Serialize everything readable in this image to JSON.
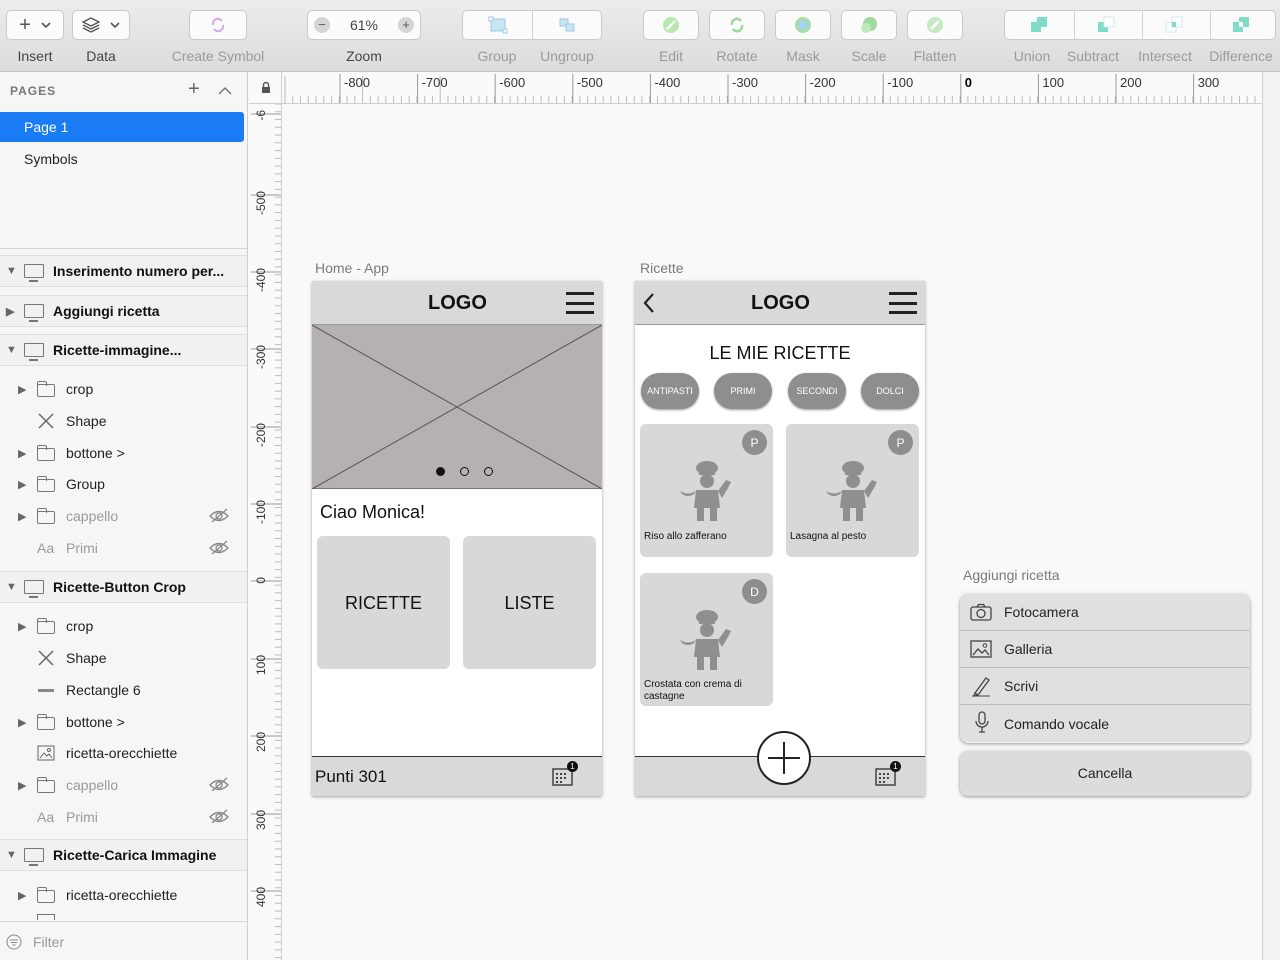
{
  "toolbar": {
    "insert_label": "Insert",
    "data_label": "Data",
    "create_symbol_label": "Create Symbol",
    "zoom_label": "Zoom",
    "zoom_value": "61%",
    "group_label": "Group",
    "ungroup_label": "Ungroup",
    "edit_label": "Edit",
    "rotate_label": "Rotate",
    "mask_label": "Mask",
    "scale_label": "Scale",
    "flatten_label": "Flatten",
    "union_label": "Union",
    "subtract_label": "Subtract",
    "intersect_label": "Intersect",
    "difference_label": "Difference"
  },
  "sidebar": {
    "pages_title": "PAGES",
    "pages": [
      "Page 1",
      "Symbols"
    ],
    "layers": [
      {
        "name": "Inserimento numero per...",
        "kind": "artboard",
        "expanded": true
      },
      {
        "name": "Aggiungi ricetta",
        "kind": "artboard",
        "expanded": false
      },
      {
        "name": "Ricette-immagine...",
        "kind": "artboard",
        "expanded": true
      },
      {
        "name": "crop",
        "kind": "folder"
      },
      {
        "name": "Shape",
        "kind": "shape"
      },
      {
        "name": "bottone >",
        "kind": "folder"
      },
      {
        "name": "Group",
        "kind": "folder"
      },
      {
        "name": "cappello",
        "kind": "folder",
        "hidden": true
      },
      {
        "name": "Primi",
        "kind": "text",
        "hidden": true
      },
      {
        "name": "Ricette-Button Crop",
        "kind": "artboard",
        "expanded": true
      },
      {
        "name": "crop",
        "kind": "folder"
      },
      {
        "name": "Shape",
        "kind": "shape"
      },
      {
        "name": "Rectangle 6",
        "kind": "rect"
      },
      {
        "name": "bottone >",
        "kind": "folder"
      },
      {
        "name": "ricetta-orecchiette",
        "kind": "image"
      },
      {
        "name": "cappello",
        "kind": "folder",
        "hidden": true
      },
      {
        "name": "Primi",
        "kind": "text",
        "hidden": true
      },
      {
        "name": "Ricette-Carica Immagine",
        "kind": "artboard",
        "expanded": true
      },
      {
        "name": "ricetta-orecchiette",
        "kind": "folder"
      }
    ],
    "filter_placeholder": "Filter",
    "text_icon_glyph": "Aa"
  },
  "ruler": {
    "top_ticks": [
      "-800",
      "-700",
      "-600",
      "-500",
      "-400",
      "-300",
      "-200",
      "-100",
      "0",
      "100",
      "200",
      "300"
    ],
    "left_ticks": [
      "-6",
      "-500",
      "-400",
      "-300",
      "-200",
      "-100",
      "0",
      "100",
      "200",
      "300",
      "400"
    ]
  },
  "artboards": {
    "home": {
      "label": "Home - App",
      "logo": "LOGO",
      "greeting": "Ciao Monica!",
      "btn_recipes": "RICETTE",
      "btn_lists": "LISTE",
      "points": "Punti 301",
      "calendar_badge": "1"
    },
    "ricette": {
      "label": "Ricette",
      "logo": "LOGO",
      "title": "LE MIE RICETTE",
      "chips": [
        "ANTIPASTI",
        "PRIMI",
        "SECONDI",
        "DOLCI"
      ],
      "recipes": [
        {
          "name": "Riso allo zafferano",
          "badge": "P"
        },
        {
          "name": "Lasagna al pesto",
          "badge": "P"
        },
        {
          "name": "Crostata con crema di castagne",
          "badge": "D"
        }
      ],
      "calendar_badge": "1"
    },
    "aggiungi": {
      "label": "Aggiungi ricetta",
      "options": [
        "Fotocamera",
        "Galleria",
        "Scrivi",
        "Comando vocale"
      ],
      "cancel": "Cancella"
    }
  },
  "colors": {
    "accent": "#1a7cf5",
    "wire_gray": "#d8d8d8",
    "chip_gray": "#8e8e8e",
    "image_placeholder": "#b5b0b1",
    "boolean_icon": "#7fdcc8"
  }
}
